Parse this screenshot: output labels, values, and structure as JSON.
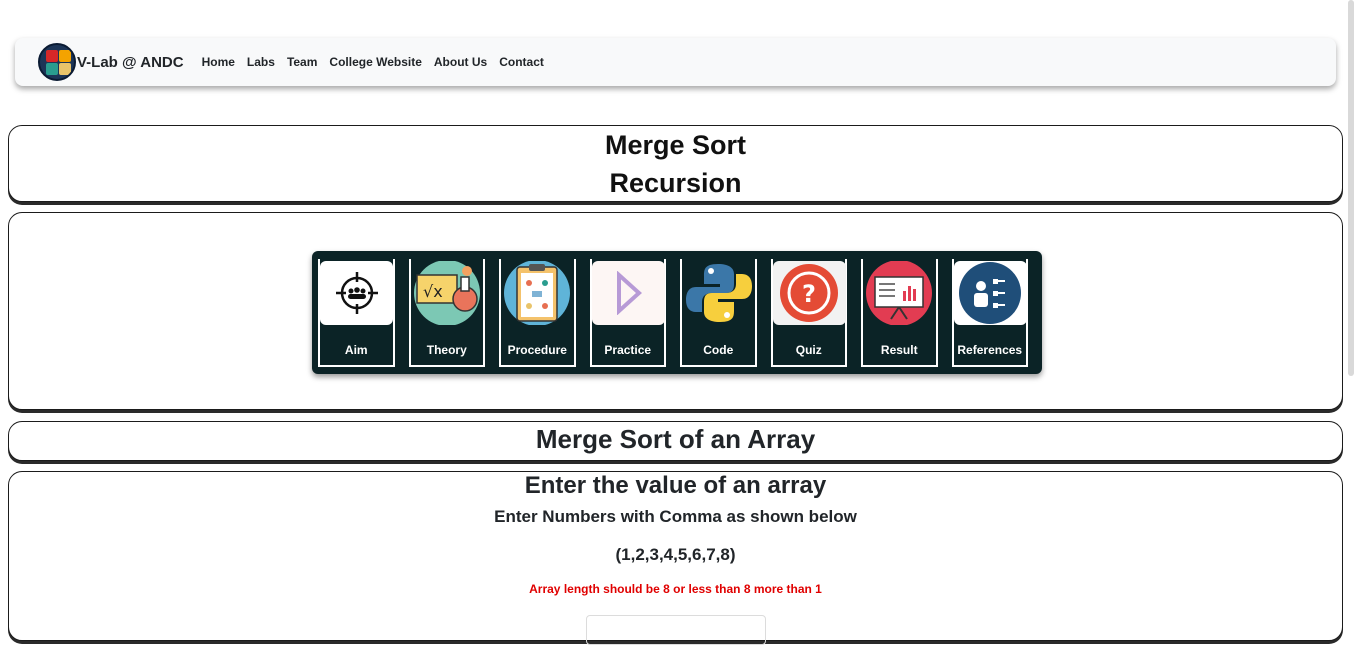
{
  "navbar": {
    "brand": "V-Lab @ ANDC",
    "links": [
      "Home",
      "Labs",
      "Team",
      "College Website",
      "About Us",
      "Contact"
    ]
  },
  "header": {
    "title": "Merge Sort",
    "subtitle": "Recursion"
  },
  "menu": {
    "items": [
      {
        "label": "Aim",
        "icon": "aim-icon"
      },
      {
        "label": "Theory",
        "icon": "theory-icon"
      },
      {
        "label": "Procedure",
        "icon": "procedure-icon"
      },
      {
        "label": "Practice",
        "icon": "practice-icon"
      },
      {
        "label": "Code",
        "icon": "python-icon"
      },
      {
        "label": "Quiz",
        "icon": "quiz-icon"
      },
      {
        "label": "Result",
        "icon": "result-icon"
      },
      {
        "label": "References",
        "icon": "references-icon"
      }
    ]
  },
  "section": {
    "title": "Merge Sort of an Array"
  },
  "input": {
    "heading": "Enter the value of an array",
    "instruction": "Enter Numbers with Comma as shown below",
    "example": "(1,2,3,4,5,6,7,8)",
    "warning": "Array length should be 8 or less than 8 more than 1",
    "value": ""
  },
  "colors": {
    "panel": "#0b2326",
    "warning": "#e00000",
    "navbar": "#f8f9fa"
  }
}
